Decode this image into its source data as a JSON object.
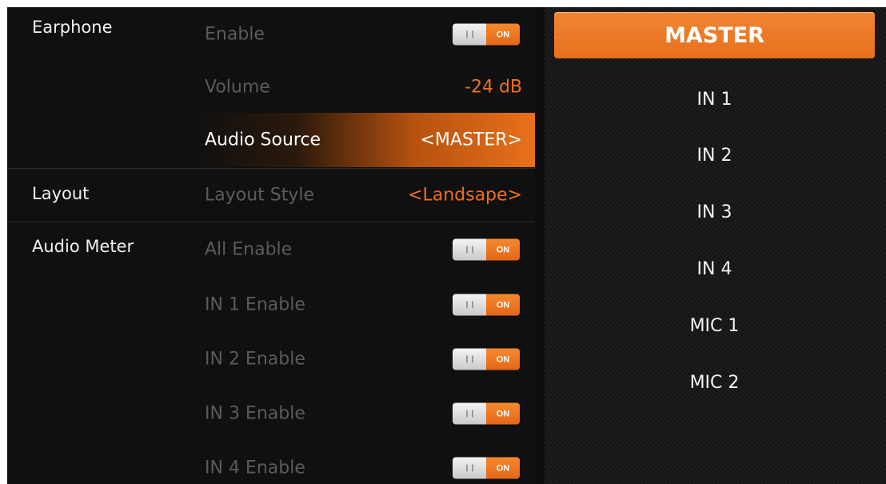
{
  "sections": {
    "earphone": "Earphone",
    "layout": "Layout",
    "audio_meter": "Audio Meter"
  },
  "earphone": {
    "enable_label": "Enable",
    "enable_toggle": "ON",
    "volume_label": "Volume",
    "volume_value": "-24 dB",
    "audio_source_label": "Audio Source",
    "audio_source_value": "<MASTER>"
  },
  "layout": {
    "style_label": "Layout Style",
    "style_value": "<Landsape>"
  },
  "audio_meter": {
    "all_enable_label": "All Enable",
    "all_enable_toggle": "ON",
    "in1_label": "IN 1 Enable",
    "in1_toggle": "ON",
    "in2_label": "IN 2 Enable",
    "in2_toggle": "ON",
    "in3_label": "IN 3 Enable",
    "in3_toggle": "ON",
    "in4_label": "IN 4 Enable",
    "in4_toggle": "ON"
  },
  "source_list": {
    "selected": "MASTER",
    "items": [
      "MASTER",
      "IN 1",
      "IN 2",
      "IN 3",
      "IN 4",
      "MIC 1",
      "MIC 2"
    ]
  },
  "colors": {
    "accent": "#e8711c",
    "background": "#101010",
    "muted_text": "#5b5b5b"
  }
}
